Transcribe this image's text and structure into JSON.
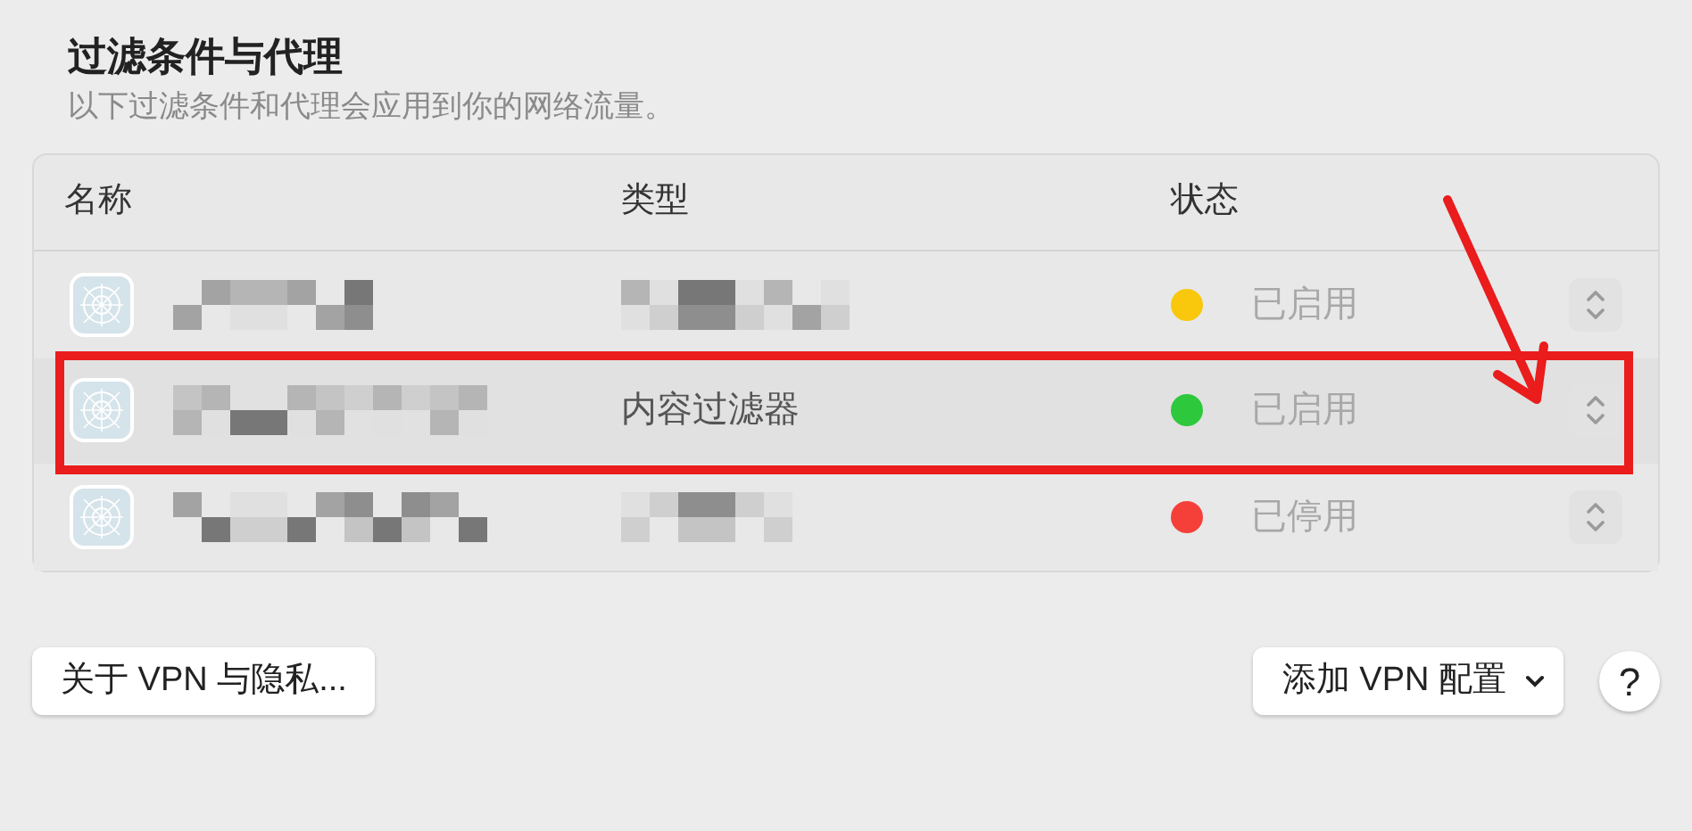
{
  "section": {
    "title": "过滤条件与代理",
    "subtitle": "以下过滤条件和代理会应用到你的网络流量。"
  },
  "table": {
    "columns": [
      "名称",
      "类型",
      "状态"
    ],
    "rows": [
      {
        "status": "已启用",
        "color": "#f9c70c",
        "highlighted": false
      },
      {
        "type": "内容过滤器",
        "status": "已启用",
        "color": "#2ec83d",
        "highlighted": true
      },
      {
        "status": "已停用",
        "color": "#f5403a",
        "highlighted": false
      }
    ]
  },
  "buttons": {
    "about": "关于 VPN 与隐私...",
    "add": "添加 VPN 配置",
    "help": "?"
  }
}
